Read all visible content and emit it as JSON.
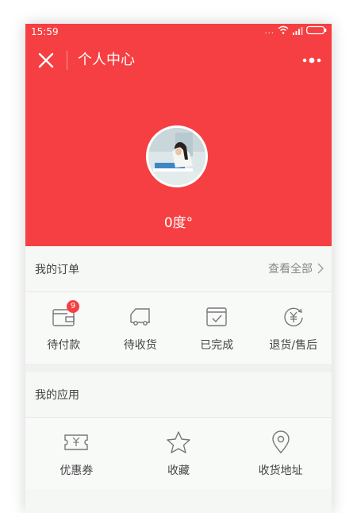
{
  "status_bar": {
    "time": "15:59",
    "dots": "..."
  },
  "nav": {
    "title": "个人中心"
  },
  "profile": {
    "name": "0度°"
  },
  "orders": {
    "title": "我的订单",
    "view_all": "查看全部",
    "items": [
      {
        "label": "待付款",
        "icon": "wallet-icon",
        "badge": "9"
      },
      {
        "label": "待收货",
        "icon": "truck-icon"
      },
      {
        "label": "已完成",
        "icon": "completed-box-icon"
      },
      {
        "label": "退货/售后",
        "icon": "refund-yen-icon"
      }
    ]
  },
  "apps": {
    "title": "我的应用",
    "items": [
      {
        "label": "优惠券",
        "icon": "coupon-icon"
      },
      {
        "label": "收藏",
        "icon": "star-icon"
      },
      {
        "label": "收货地址",
        "icon": "location-pin-icon"
      }
    ]
  },
  "colors": {
    "accent": "#f63f42",
    "background": "#f4f7f4",
    "text": "#444444",
    "muted": "#888888"
  }
}
